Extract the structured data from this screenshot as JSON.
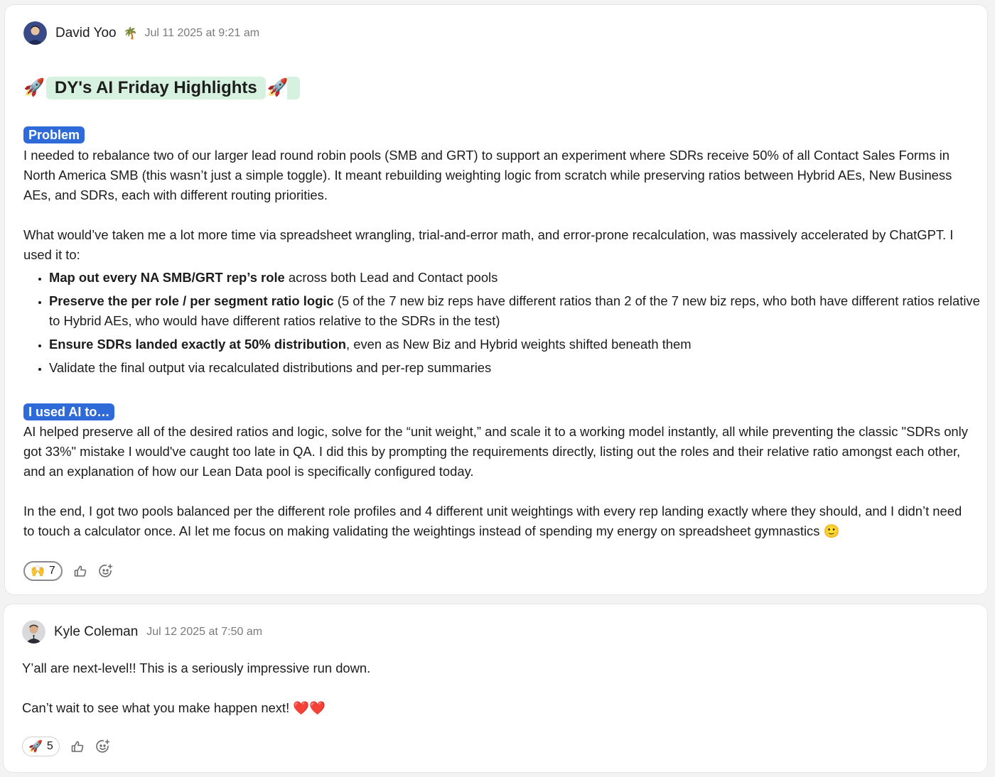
{
  "post1": {
    "author": "David Yoo",
    "status_emoji": "🌴",
    "timestamp": "Jul 11 2025 at 9:21 am",
    "title_left_emoji": "🚀",
    "title": "DY's AI Friday Highlights",
    "title_right_emoji": "🚀",
    "problem_label": "Problem",
    "problem_text": "I needed to rebalance two of our larger lead round robin pools (SMB and GRT) to support an experiment where SDRs receive 50% of all Contact Sales Forms in North America SMB (this wasn’t just a simple toggle). It meant rebuilding weighting logic from scratch while preserving ratios between Hybrid AEs, New Business AEs, and SDRs, each with different routing priorities.",
    "intro_text": "What would’ve taken me a lot more time via spreadsheet wrangling, trial-and-error math, and error-prone recalculation, was massively accelerated by ChatGPT. I used it to:",
    "bullets": [
      {
        "bold": "Map out every NA SMB/GRT rep’s role",
        "rest": " across both Lead and Contact pools"
      },
      {
        "bold": "Preserve the per role / per segment ratio logic",
        "rest": " (5 of the 7 new biz reps have different ratios than 2 of the 7 new biz reps, who both have different ratios relative to Hybrid AEs, who would have different ratios relative to the SDRs in the test)"
      },
      {
        "bold": "Ensure SDRs landed exactly at 50% distribution",
        "rest": ", even as New Biz and Hybrid weights shifted beneath them"
      },
      {
        "bold": "",
        "rest": "Validate the final output via recalculated distributions and per-rep summaries"
      }
    ],
    "used_ai_label": "I used AI to…",
    "used_ai_text": "AI helped preserve all of the desired ratios and logic, solve for the “unit weight,” and scale it to a working model instantly, all while preventing the classic \"SDRs only got 33%\" mistake I would've caught too late in QA. I did this by prompting the requirements directly, listing out the roles and their relative ratio amongst each other, and an explanation of how our Lean Data pool is specifically configured today.",
    "end_text": "In the end, I got two pools balanced per the different role profiles and 4 different unit weightings with every rep landing exactly where they should, and I didn’t need to touch a calculator once. AI let me focus on making validating the weightings instead of spending my energy on spreadsheet gymnastics 🙂",
    "reaction": {
      "emoji": "🙌",
      "count": "7"
    }
  },
  "post2": {
    "author": "Kyle Coleman",
    "timestamp": "Jul 12 2025 at 7:50 am",
    "line1": "Y’all are next-level!! This is a seriously impressive run down.",
    "line2": "Can’t wait to see what you make happen next! ❤️❤️",
    "reaction": {
      "emoji": "🚀",
      "count": "5"
    }
  },
  "colors": {
    "label_blue": "#2f6bd8",
    "title_highlight": "#d6f1df",
    "timestamp_gray": "#7a7a7e"
  }
}
